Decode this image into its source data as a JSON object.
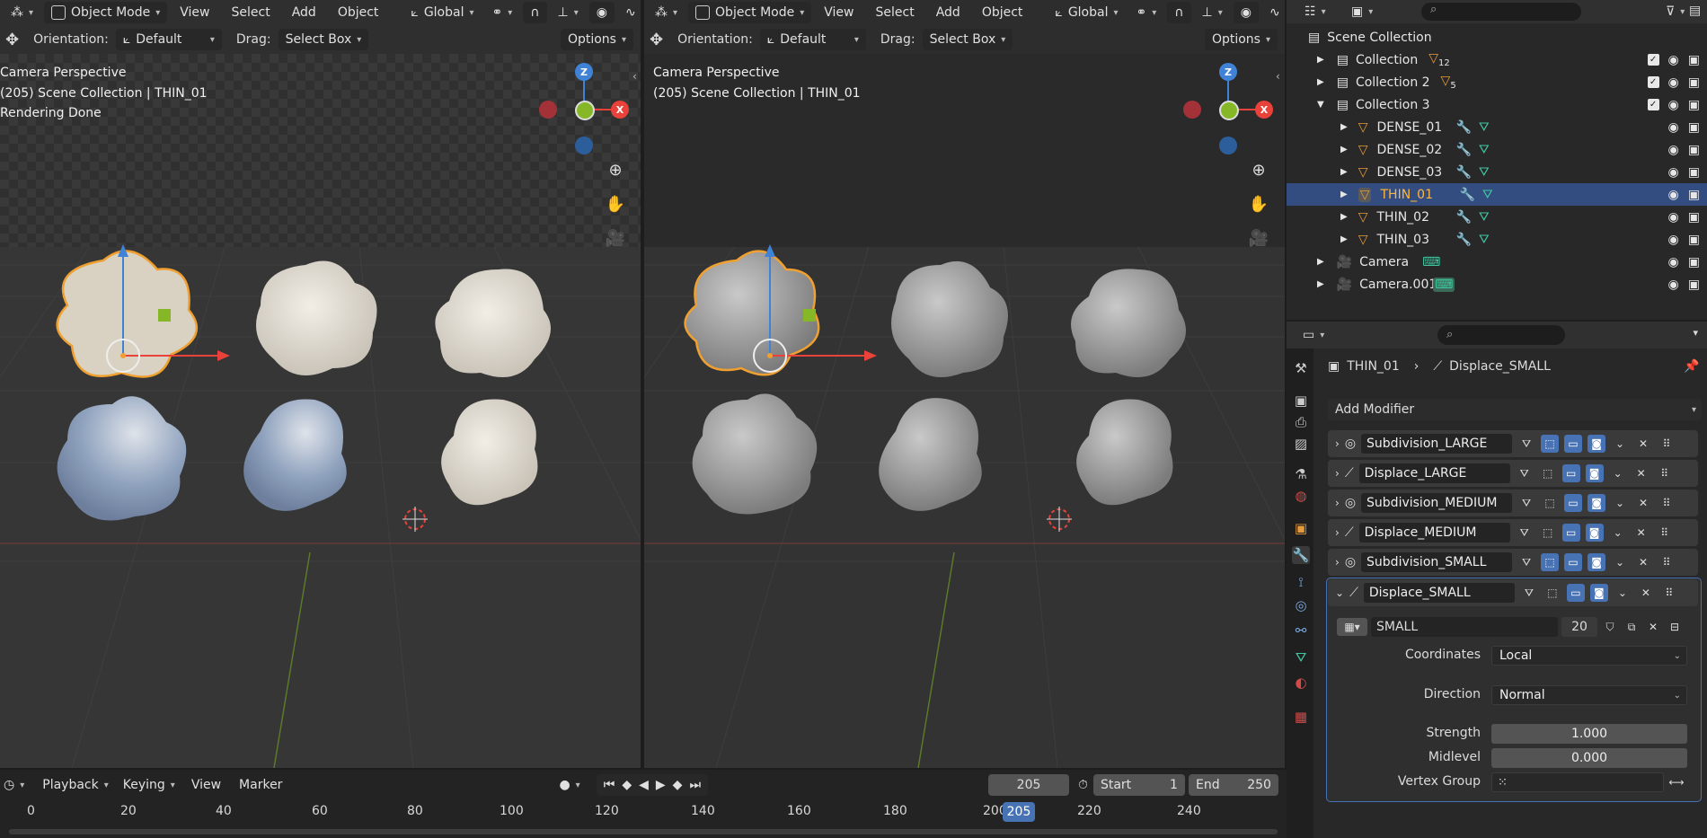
{
  "viewport_header": {
    "mode": "Object Mode",
    "menus": [
      "View",
      "Select",
      "Add",
      "Object"
    ],
    "transform_orientation": "Global"
  },
  "viewport_tool": {
    "orientation_label": "Orientation:",
    "orientation_value": "Default",
    "drag_label": "Drag:",
    "drag_value": "Select Box",
    "options": "Options"
  },
  "viewport_left": {
    "info_lines": [
      "Camera Perspective",
      "(205) Scene Collection | THIN_01",
      "Rendering Done"
    ]
  },
  "viewport_right": {
    "info_lines": [
      "Camera Perspective",
      "(205) Scene Collection | THIN_01"
    ]
  },
  "gizmo": {
    "z": "Z",
    "y": "Y",
    "x": "X"
  },
  "outliner": {
    "root": "Scene Collection",
    "items": [
      {
        "name": "Collection",
        "indent": 0,
        "count": "12",
        "checkbox": true
      },
      {
        "name": "Collection 2",
        "indent": 0,
        "count": "5",
        "checkbox": true
      },
      {
        "name": "Collection 3",
        "indent": 0,
        "count": "",
        "checkbox": true,
        "expanded": true
      },
      {
        "name": "DENSE_01",
        "indent": 1
      },
      {
        "name": "DENSE_02",
        "indent": 1
      },
      {
        "name": "DENSE_03",
        "indent": 1
      },
      {
        "name": "THIN_01",
        "indent": 1,
        "selected": true
      },
      {
        "name": "THIN_02",
        "indent": 1
      },
      {
        "name": "THIN_03",
        "indent": 1
      },
      {
        "name": "Camera",
        "indent": 0,
        "type": "camera"
      },
      {
        "name": "Camera.001",
        "indent": 0,
        "type": "camera"
      }
    ]
  },
  "properties": {
    "breadcrumb_object": "THIN_01",
    "breadcrumb_modifier": "Displace_SMALL",
    "add_modifier": "Add Modifier",
    "modifiers": [
      {
        "name": "Subdivision_LARGE",
        "type": "subdivision"
      },
      {
        "name": "Displace_LARGE",
        "type": "displace"
      },
      {
        "name": "Subdivision_MEDIUM",
        "type": "subdivision"
      },
      {
        "name": "Displace_MEDIUM",
        "type": "displace"
      },
      {
        "name": "Subdivision_SMALL",
        "type": "subdivision"
      },
      {
        "name": "Displace_SMALL",
        "type": "displace",
        "expanded": true
      }
    ],
    "texture_name": "SMALL",
    "texture_users": "20",
    "coordinates_label": "Coordinates",
    "coordinates_value": "Local",
    "direction_label": "Direction",
    "direction_value": "Normal",
    "strength_label": "Strength",
    "strength_value": "1.000",
    "midlevel_label": "Midlevel",
    "midlevel_value": "0.000",
    "vertex_group_label": "Vertex Group"
  },
  "timeline": {
    "menus": [
      "Playback",
      "Keying",
      "View",
      "Marker"
    ],
    "current_frame": "205",
    "start_label": "Start",
    "start_value": "1",
    "end_label": "End",
    "end_value": "250",
    "ruler": [
      "0",
      "20",
      "40",
      "60",
      "80",
      "100",
      "120",
      "140",
      "160",
      "180",
      "200",
      "220",
      "240"
    ],
    "playhead": "205"
  },
  "colors": {
    "accent_blue": "#4772b3",
    "selection": "#334d80",
    "outline_orange": "#f0a030",
    "axis_x": "#e8423a",
    "axis_y": "#85b727",
    "axis_z": "#3f82d6"
  }
}
